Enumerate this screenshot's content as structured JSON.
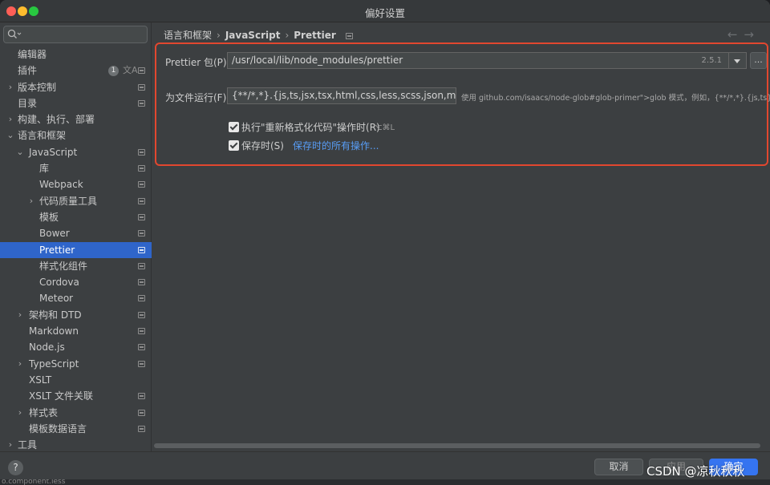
{
  "window": {
    "title": "偏好设置"
  },
  "search": {
    "placeholder": ""
  },
  "sidebar": {
    "items": [
      {
        "label": "编辑器",
        "arrow": "",
        "indent": 0,
        "proj": false
      },
      {
        "label": "插件",
        "arrow": "",
        "indent": 0,
        "proj": true,
        "badge": "1"
      },
      {
        "label": "版本控制",
        "arrow": "›",
        "indent": 0,
        "proj": true
      },
      {
        "label": "目录",
        "arrow": "",
        "indent": 0,
        "proj": true
      },
      {
        "label": "构建、执行、部署",
        "arrow": "›",
        "indent": 0,
        "proj": false
      },
      {
        "label": "语言和框架",
        "arrow": "⌄",
        "indent": 0,
        "proj": false
      },
      {
        "label": "JavaScript",
        "arrow": "⌄",
        "indent": 1,
        "proj": true
      },
      {
        "label": "库",
        "arrow": "",
        "indent": 2,
        "proj": true
      },
      {
        "label": "Webpack",
        "arrow": "",
        "indent": 2,
        "proj": true
      },
      {
        "label": "代码质量工具",
        "arrow": "›",
        "indent": 2,
        "proj": true
      },
      {
        "label": "模板",
        "arrow": "",
        "indent": 2,
        "proj": true
      },
      {
        "label": "Bower",
        "arrow": "",
        "indent": 2,
        "proj": true
      },
      {
        "label": "Prettier",
        "arrow": "",
        "indent": 2,
        "proj": true,
        "selected": true
      },
      {
        "label": "样式化组件",
        "arrow": "",
        "indent": 2,
        "proj": true
      },
      {
        "label": "Cordova",
        "arrow": "",
        "indent": 2,
        "proj": true
      },
      {
        "label": "Meteor",
        "arrow": "",
        "indent": 2,
        "proj": true
      },
      {
        "label": "架构和 DTD",
        "arrow": "›",
        "indent": 1,
        "proj": true
      },
      {
        "label": "Markdown",
        "arrow": "",
        "indent": 1,
        "proj": true
      },
      {
        "label": "Node.js",
        "arrow": "",
        "indent": 1,
        "proj": true
      },
      {
        "label": "TypeScript",
        "arrow": "›",
        "indent": 1,
        "proj": true
      },
      {
        "label": "XSLT",
        "arrow": "",
        "indent": 1,
        "proj": false
      },
      {
        "label": "XSLT 文件关联",
        "arrow": "",
        "indent": 1,
        "proj": true
      },
      {
        "label": "样式表",
        "arrow": "›",
        "indent": 1,
        "proj": true
      },
      {
        "label": "模板数据语言",
        "arrow": "",
        "indent": 1,
        "proj": true
      },
      {
        "label": "工具",
        "arrow": "›",
        "indent": 0,
        "proj": false
      }
    ]
  },
  "breadcrumb": {
    "part1": "语言和框架",
    "part2": "JavaScript",
    "part3": "Prettier",
    "sep": "›"
  },
  "nav": {
    "back": "←",
    "forward": "→"
  },
  "prettier": {
    "package_label": "Prettier 包(P):",
    "package_value": "/usr/local/lib/node_modules/prettier",
    "version": "2.5.1",
    "browse_label": "...",
    "run_for_label": "为文件运行(F):",
    "run_for_value": "{**/*,*}.{js,ts,jsx,tsx,html,css,less,scss,json,md,vue}",
    "glob_hint": "使用 github.com/isaacs/node-glob#glob-primer\">glob 模式，例如，{**/*,*}.{js,ts}",
    "on_reformat_label": "执行\"重新格式化代码\"操作时(R)",
    "on_reformat_shortcut": "⌥⌘L",
    "on_save_label": "保存时(S)",
    "all_save_actions_link": "保存时的所有操作..."
  },
  "footer": {
    "help": "?",
    "cancel": "取消",
    "apply": "应用",
    "ok": "确定",
    "watermark": "CSDN @凉秋秋秋"
  },
  "background_strip": {
    "text": "o.component.less"
  },
  "colors": {
    "selection": "#2f65ca",
    "accent": "#3574f0",
    "link": "#589df6",
    "highlight_border": "#e2472f"
  }
}
